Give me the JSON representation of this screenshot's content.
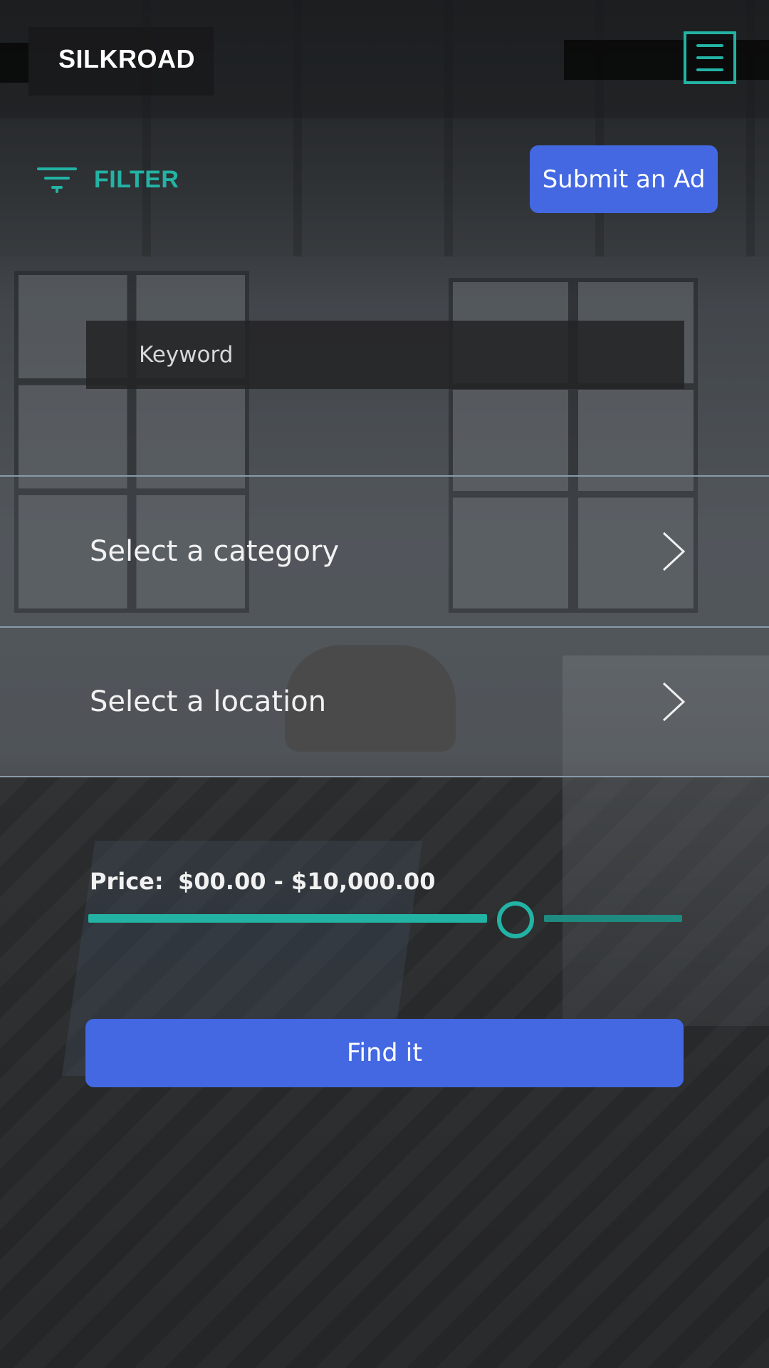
{
  "header": {
    "brand": "SILKROAD",
    "menu_icon": "hamburger-menu-icon",
    "accent_color": "#23b3a4"
  },
  "toolbar": {
    "filter_label": "FILTER",
    "filter_icon": "filter-icon",
    "submit_label": "Submit an Ad",
    "button_color": "#4368e2"
  },
  "search": {
    "keyword_placeholder": "Keyword",
    "keyword_value": ""
  },
  "selects": {
    "category_label": "Select a category",
    "location_label": "Select a location",
    "chevron_icon": "chevron-right-icon"
  },
  "price": {
    "label": "Price:",
    "range_text": "$00.00 - $10,000.00",
    "min": 0,
    "max": 10000,
    "slider_position": 0.72
  },
  "actions": {
    "find_label": "Find it"
  }
}
